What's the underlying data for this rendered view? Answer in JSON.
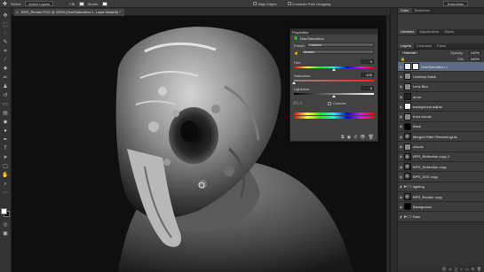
{
  "options_bar": {
    "select_label": "Select:",
    "select_value": "Active Layers",
    "fill_label": "Fill:",
    "stroke_label": "Stroke:",
    "align_edges": "Align Edges",
    "constrain": "Constrain Path Dragging",
    "workspace": "Essentials"
  },
  "document_tab": {
    "title": "BPR_Render.PSD @ 200% (Hue/Saturation 1, Layer Mask/8) *"
  },
  "properties": {
    "panel_title": "Properties",
    "adjustment_name": "Hue/Saturation",
    "preset_label": "Preset:",
    "preset_value": "Custom",
    "channel_value": "Master",
    "hue_label": "Hue:",
    "hue_value": "0",
    "saturation_label": "Saturation:",
    "saturation_value": "-100",
    "lightness_label": "Lightness:",
    "lightness_value": "0",
    "colorize_label": "Colorize",
    "hue_fraction": 0.5,
    "saturation_fraction": 0.0,
    "lightness_fraction": 0.5
  },
  "right_panel": {
    "tabs_top": [
      "Color",
      "Swatches"
    ],
    "tabs_mid": [
      "Libraries",
      "Adjustments",
      "Styles"
    ],
    "tabs_layers": [
      "Layers",
      "Channels",
      "Paths"
    ],
    "blend_mode": "Normal",
    "opacity_label": "Opacity:",
    "opacity_value": "100%",
    "fill_label": "Fill:",
    "fill_value": "100%",
    "layers": [
      {
        "name": "Hue/Saturation 1",
        "thumb": "t-white",
        "mask": true,
        "selected": true
      },
      {
        "name": "Unsharp Mask",
        "thumb": "t-gray",
        "mask": false,
        "selected": false
      },
      {
        "name": "Lens Blur",
        "thumb": "t-gray",
        "mask": false,
        "selected": false
      },
      {
        "name": "drool",
        "thumb": "t-dark",
        "mask": false,
        "selected": false
      },
      {
        "name": "background adjust",
        "thumb": "t-white",
        "mask": false,
        "selected": false
      },
      {
        "name": "front clouds",
        "thumb": "t-gray",
        "mask": false,
        "selected": false
      },
      {
        "name": "black",
        "thumb": "t-black",
        "mask": false,
        "selected": false
      },
      {
        "name": "Merged Filter+RenderLights",
        "thumb": "t-creature",
        "mask": false,
        "selected": false
      },
      {
        "name": "clouds",
        "thumb": "t-gray",
        "mask": false,
        "selected": false
      },
      {
        "name": "BPR_Reflection copy 2",
        "thumb": "t-creature",
        "mask": false,
        "selected": false
      },
      {
        "name": "BPR_Reflection copy",
        "thumb": "t-creature",
        "mask": false,
        "selected": false
      },
      {
        "name": "BPR_SSS copy",
        "thumb": "t-creature",
        "mask": false,
        "selected": false
      },
      {
        "name": "lighting",
        "thumb": "t-folder",
        "mask": false,
        "selected": false
      },
      {
        "name": "BPR_Render copy",
        "thumb": "t-creature",
        "mask": false,
        "selected": false
      },
      {
        "name": "Background",
        "thumb": "t-black",
        "mask": false,
        "selected": false
      },
      {
        "name": "Raw",
        "thumb": "t-folder",
        "mask": false,
        "selected": false
      }
    ]
  },
  "colors": {
    "panel": "#424242",
    "selected_layer": "#5b6c84",
    "canvas_bg": "#101010"
  }
}
